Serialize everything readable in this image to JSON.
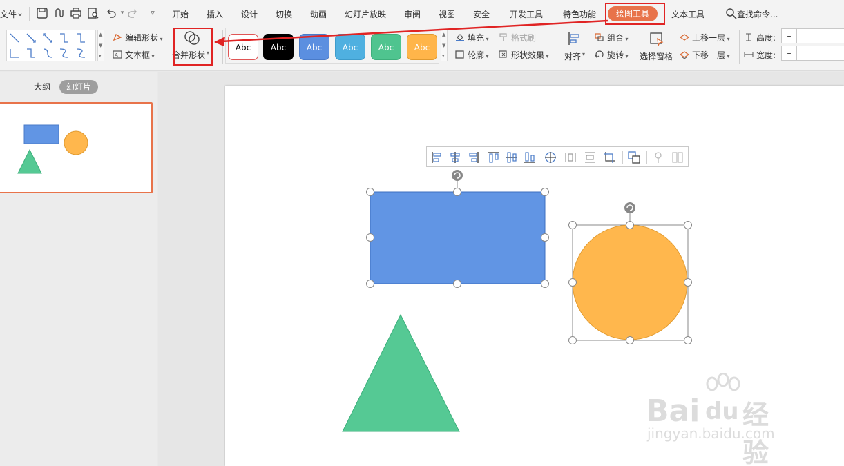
{
  "menu": {
    "file": "文件",
    "tabs": [
      "开始",
      "插入",
      "设计",
      "切换",
      "动画",
      "幻灯片放映",
      "审阅",
      "视图",
      "安全",
      "开发工具",
      "特色功能"
    ],
    "active_tab": "绘图工具",
    "text_tools": "文本工具",
    "search": "查找命令..."
  },
  "ribbon": {
    "edit_shape": "编辑形状",
    "text_box": "文本框",
    "merge_shape": "合并形状",
    "style_presets": [
      {
        "label": "Abc",
        "bg": "#ffffff",
        "fg": "#000000",
        "border": "#e05555"
      },
      {
        "label": "Abc",
        "bg": "#000000",
        "fg": "#ffffff",
        "border": "#000000"
      },
      {
        "label": "Abc",
        "bg": "#5b8fe0",
        "fg": "#ffffff",
        "border": "#4a7bc8"
      },
      {
        "label": "Abc",
        "bg": "#4fb0e0",
        "fg": "#ffffff",
        "border": "#3d9bca"
      },
      {
        "label": "Abc",
        "bg": "#4fc48f",
        "fg": "#ffffff",
        "border": "#3daf7b"
      },
      {
        "label": "Abc",
        "bg": "#ffb54a",
        "fg": "#ffffff",
        "border": "#e09a30"
      }
    ],
    "fill": "填充",
    "format_painter": "格式刷",
    "outline": "轮廓",
    "shape_effects": "形状效果",
    "align": "对齐",
    "group": "组合",
    "rotate": "旋转",
    "selection_pane": "选择窗格",
    "bring_forward": "上移一层",
    "send_backward": "下移一层",
    "height": "高度:",
    "width": "宽度:",
    "height_value": "–",
    "width_value": "–"
  },
  "left_panel": {
    "outline_tab": "大纲",
    "slides_tab": "幻灯片"
  },
  "colors": {
    "accent": "#e8734a",
    "highlight_red": "#e02424",
    "rect_fill": "#6195e4",
    "circle_fill": "#ffb74d",
    "triangle_fill": "#55c994"
  },
  "watermark": {
    "brand": "Bai",
    "brand2": "du",
    "brand3": "经验",
    "url": "jingyan.baidu.com"
  }
}
